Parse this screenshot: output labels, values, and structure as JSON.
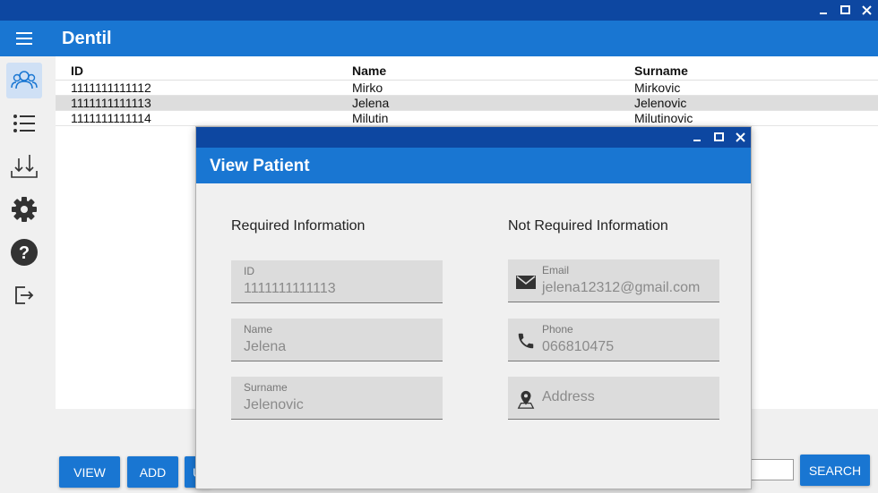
{
  "window": {
    "minimize": "_",
    "maximize": "□",
    "close": "×"
  },
  "app": {
    "title": "Dentil"
  },
  "sidebar": {
    "items": [
      "patients-icon",
      "list-icon",
      "import-icon",
      "gear-icon",
      "help-icon",
      "logout-icon"
    ]
  },
  "table": {
    "headers": [
      "ID",
      "Name",
      "Surname"
    ],
    "rows": [
      [
        "1111111111112",
        "Mirko",
        "Mirkovic"
      ],
      [
        "1111111111113",
        "Jelena",
        "Jelenovic"
      ],
      [
        "1111111111114",
        "Milutin",
        "Milutinovic"
      ]
    ]
  },
  "buttons": {
    "view": "VIEW",
    "add": "ADD",
    "partial": "U",
    "search": "SEARCH"
  },
  "dialog": {
    "title": "View Patient",
    "required_title": "Required Information",
    "optional_title": "Not Required Information",
    "id": {
      "label": "ID",
      "value": "1111111111113"
    },
    "name": {
      "label": "Name",
      "value": "Jelena"
    },
    "surname": {
      "label": "Surname",
      "value": "Jelenovic"
    },
    "email": {
      "label": "Email",
      "value": "jelena12312@gmail.com"
    },
    "phone": {
      "label": "Phone",
      "value": "066810475"
    },
    "address": {
      "placeholder": "Address"
    }
  },
  "colors": {
    "primary": "#1976d2",
    "titlebar": "#0d47a1",
    "selected_row": "#dddddd"
  }
}
